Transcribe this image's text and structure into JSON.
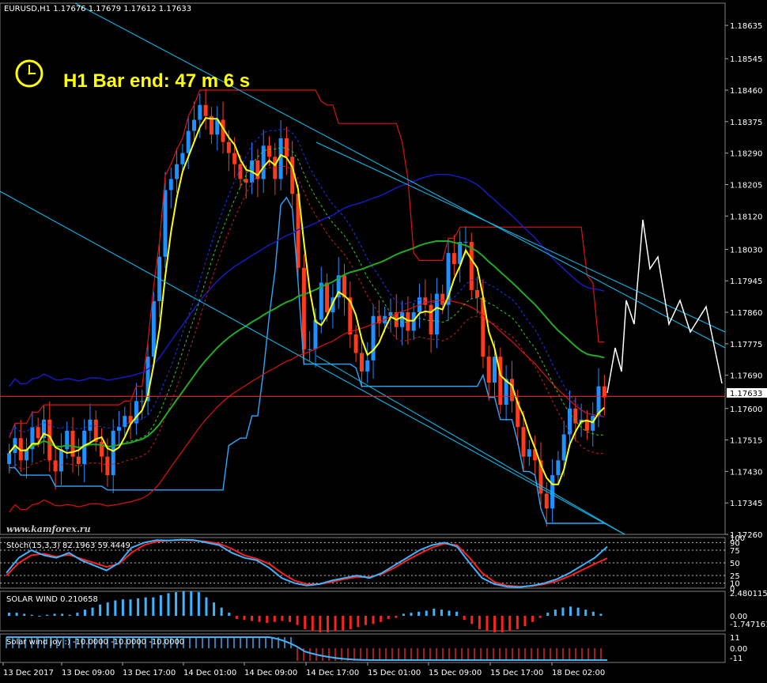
{
  "header": {
    "symbol_line": "EURUSD,H1  1.17676 1.17679 1.17612 1.17633",
    "timer_text": "H1 Bar end: 47 m 6 s",
    "watermark": "www.kamforex.ru"
  },
  "colors": {
    "background": "#000000",
    "grid": "#2a2a2a",
    "bull_candle": "#1e90ff",
    "bear_candle": "#ff3b1f",
    "current_price_line": "#ff2020",
    "donchian": "#e01010",
    "trend_lines": "#00c8ff",
    "ma_yellow": "#ffff00",
    "ma_green": "#22aa22",
    "bands_blue": "#1a1acc",
    "stoch_main": "#3cb4ff",
    "stoch_signal": "#ff2020"
  },
  "chart_data": [
    {
      "type": "candlestick",
      "title": "EURUSD,H1",
      "ohlc_readout": [
        1.17676,
        1.17679,
        1.17612,
        1.17633
      ],
      "ylim": [
        1.1726,
        1.18695
      ],
      "y_tick_labels": [
        "1.18635",
        "1.18545",
        "1.18460",
        "1.18375",
        "1.18290",
        "1.18205",
        "1.18120",
        "1.18030",
        "1.17945",
        "1.17860",
        "1.17775",
        "1.17690",
        "1.17600",
        "1.17515",
        "1.17430",
        "1.17345",
        "1.17260"
      ],
      "current_price": "1.17633",
      "current_price_value": 1.17633,
      "x_tick_labels": [
        "13 Dec 2017",
        "13 Dec 09:00",
        "13 Dec 17:00",
        "14 Dec 01:00",
        "14 Dec 09:00",
        "14 Dec 17:00",
        "15 Dec 01:00",
        "15 Dec 09:00",
        "15 Dec 17:00",
        "18 Dec 02:00"
      ],
      "close_path": [
        1.1748,
        1.1752,
        1.1746,
        1.1749,
        1.1755,
        1.1752,
        1.1757,
        1.1746,
        1.1743,
        1.1749,
        1.1754,
        1.1747,
        1.1745,
        1.1754,
        1.1757,
        1.1751,
        1.1747,
        1.1742,
        1.1754,
        1.1755,
        1.1758,
        1.1756,
        1.1762,
        1.1762,
        1.1774,
        1.1789,
        1.1801,
        1.1819,
        1.1822,
        1.1826,
        1.1829,
        1.1835,
        1.1838,
        1.1842,
        1.1839,
        1.1834,
        1.1838,
        1.1832,
        1.1829,
        1.1826,
        1.1822,
        1.1821,
        1.1827,
        1.1822,
        1.1831,
        1.1828,
        1.1822,
        1.1833,
        1.1828,
        1.1818,
        1.1798,
        1.1776,
        1.1776,
        1.1784,
        1.1794,
        1.1786,
        1.179,
        1.1796,
        1.179,
        1.178,
        1.1775,
        1.177,
        1.1773,
        1.1785,
        1.1783,
        1.1785,
        1.1786,
        1.1782,
        1.1786,
        1.1781,
        1.1786,
        1.179,
        1.1788,
        1.178,
        1.1791,
        1.1788,
        1.1802,
        1.1799,
        1.1805,
        1.1805,
        1.1792,
        1.179,
        1.1774,
        1.1767,
        1.1774,
        1.1761,
        1.1768,
        1.1762,
        1.1755,
        1.1747,
        1.1749,
        1.1746,
        1.1737,
        1.1733,
        1.1742,
        1.1746,
        1.1753,
        1.176,
        1.1756,
        1.1757,
        1.1754,
        1.1758,
        1.1766,
        1.1763
      ]
    },
    {
      "type": "line",
      "title": "Stoch(15,3,3) 82.1963 59.4449",
      "indicator_label": "Stoch(15,3,3) 82.1963 59.4449",
      "ylim": [
        0,
        100
      ],
      "y_tick_labels": [
        "100",
        "90",
        "75",
        "50",
        "25",
        "10",
        "0"
      ],
      "series": [
        {
          "values": [
            30,
            60,
            75,
            65,
            60,
            70,
            55,
            45,
            35,
            50,
            80,
            90,
            95,
            94,
            96,
            95,
            90,
            85,
            70,
            60,
            55,
            40,
            20,
            10,
            5,
            8,
            15,
            20,
            25,
            20,
            30,
            45,
            60,
            75,
            85,
            90,
            82,
            50,
            20,
            8,
            3,
            2,
            5,
            10,
            18,
            30,
            45,
            60,
            82
          ]
        },
        {
          "values": [
            25,
            50,
            65,
            68,
            62,
            66,
            58,
            50,
            42,
            48,
            70,
            85,
            92,
            94,
            95,
            94,
            92,
            88,
            78,
            65,
            58,
            48,
            30,
            15,
            8,
            8,
            12,
            18,
            22,
            22,
            28,
            40,
            55,
            68,
            80,
            88,
            85,
            60,
            30,
            12,
            5,
            3,
            4,
            8,
            14,
            24,
            36,
            48,
            59
          ]
        }
      ]
    },
    {
      "type": "bar",
      "title": "SOLAR WIND 0.210658",
      "indicator_label": "SOLAR WIND 0.210658",
      "y_tick_labels": [
        "2.480115",
        "0.00",
        "-1.747161"
      ],
      "values": [
        0.3,
        0.3,
        0.2,
        0.1,
        0.0,
        0.1,
        0.2,
        0.2,
        0.1,
        0.3,
        0.6,
        0.8,
        1.1,
        1.3,
        1.5,
        1.6,
        1.6,
        1.7,
        1.8,
        1.8,
        2.0,
        2.2,
        2.3,
        2.4,
        2.4,
        2.3,
        1.8,
        1.3,
        0.8,
        0.3,
        -0.3,
        -0.4,
        -0.5,
        -0.6,
        -0.7,
        -0.6,
        -0.5,
        -0.6,
        -0.9,
        -1.3,
        -1.5,
        -1.6,
        -1.6,
        -1.5,
        -1.4,
        -1.3,
        -1.1,
        -0.9,
        -0.8,
        -0.6,
        -0.3,
        -0.2,
        0.2,
        0.3,
        0.4,
        0.5,
        0.7,
        0.6,
        0.5,
        0.4,
        -0.4,
        -0.8,
        -1.3,
        -1.5,
        -1.6,
        -1.6,
        -1.5,
        -1.3,
        -1.0,
        -0.6,
        -0.2,
        0.3,
        0.6,
        0.8,
        0.9,
        0.8,
        0.6,
        0.4,
        0.2
      ]
    },
    {
      "type": "bar",
      "title": "Solar wind joy :) -10.0000 -10.0000 -10.0000",
      "indicator_label": "Solar wind joy :) -10.0000 -10.0000 -10.0000",
      "y_tick_labels": [
        "11",
        "0.00",
        "-11"
      ],
      "values_sign_pattern": "positive then negative"
    }
  ]
}
